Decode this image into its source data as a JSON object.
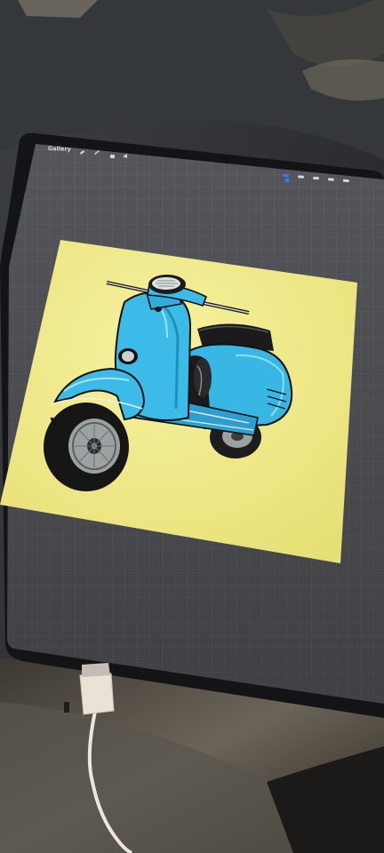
{
  "toolbar": {
    "gallery_label": "Gallery",
    "icons": [
      "wrench-icon",
      "magic-wand-icon",
      "selection-icon",
      "transform-arrow-icon"
    ]
  },
  "right_tools": [
    "brush-icon",
    "smudge-icon",
    "eraser-icon",
    "layers-icon",
    "color-icon"
  ],
  "canvas": {
    "background_color": "#f1ec8a",
    "scooter_color": "#39b8e6"
  }
}
